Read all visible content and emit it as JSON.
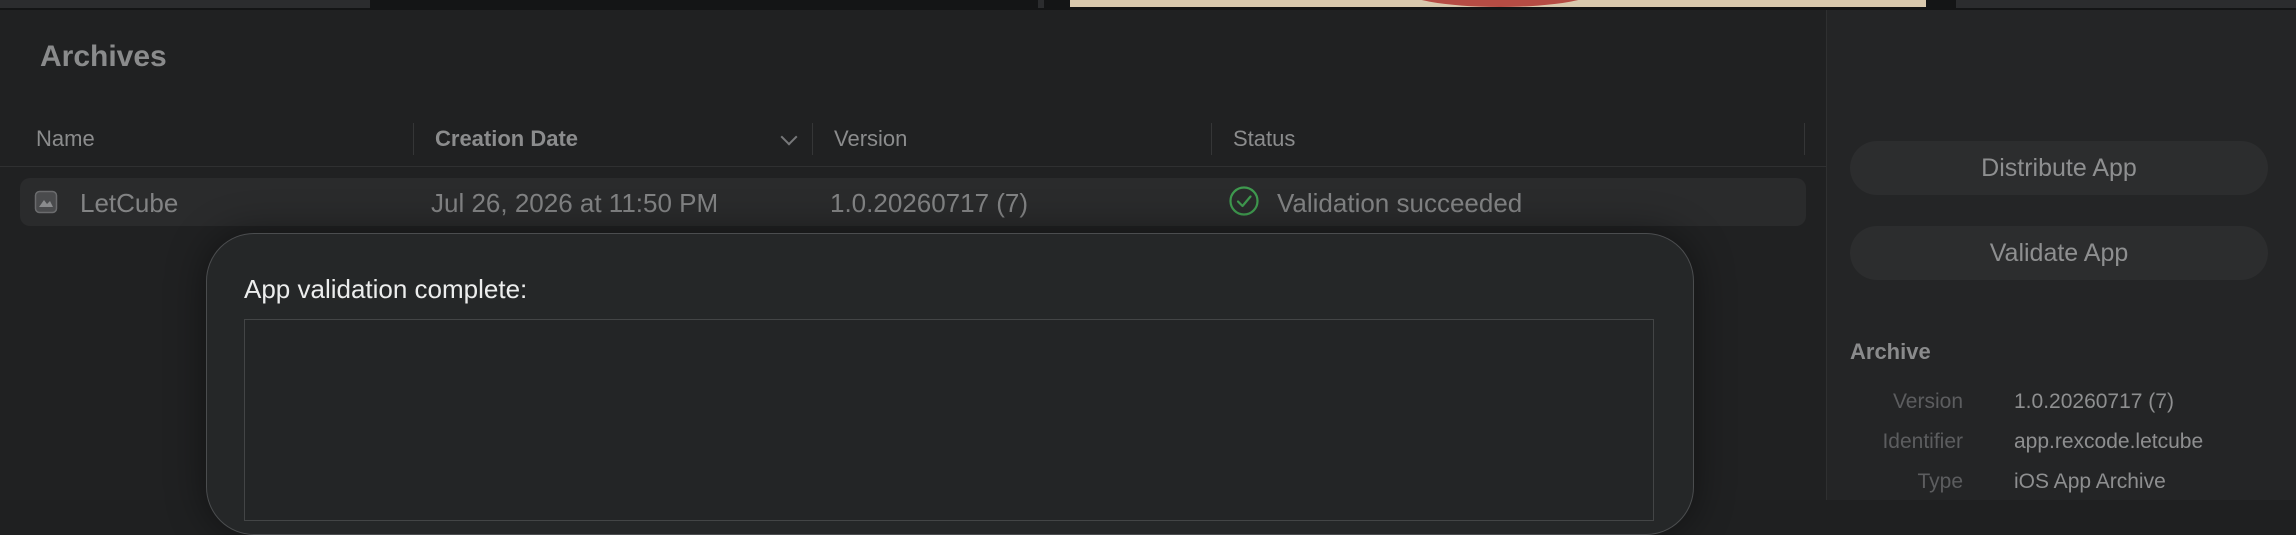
{
  "archives": {
    "title": "Archives",
    "columns": {
      "name": "Name",
      "creation_date": "Creation Date",
      "version": "Version",
      "status": "Status"
    },
    "rows": [
      {
        "name": "LetCube",
        "icon": "archive-file-icon",
        "creation_date": "Jul 26, 2026 at 11:50 PM",
        "version": "1.0.20260717 (7)",
        "status": "Validation succeeded",
        "status_icon": "checkmark-circle-icon",
        "status_color": "#3f9a4f"
      }
    ]
  },
  "sidebar": {
    "distribute_label": "Distribute App",
    "validate_label": "Validate App",
    "section_title": "Archive",
    "details": [
      {
        "key": "Version",
        "value": "1.0.20260717 (7)"
      },
      {
        "key": "Identifier",
        "value": "app.rexcode.letcube"
      },
      {
        "key": "Type",
        "value": "iOS App Archive"
      }
    ]
  },
  "sheet": {
    "title": "App validation complete:"
  }
}
